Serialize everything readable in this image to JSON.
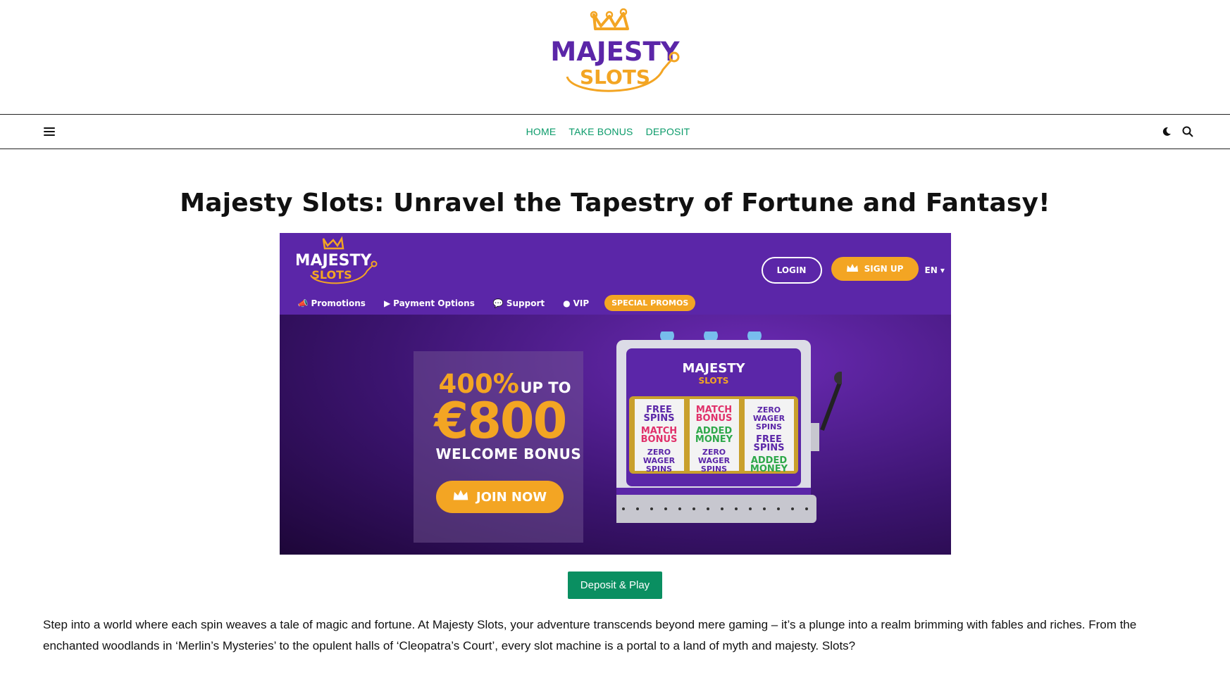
{
  "site": {
    "logo_top": "MAJESTY",
    "logo_bottom": "SLOTS"
  },
  "nav": {
    "links": [
      "HOME",
      "TAKE BONUS",
      "DEPOSIT"
    ],
    "menu_icon": "hamburger-icon",
    "dark_mode_icon": "moon-icon",
    "search_icon": "search-icon"
  },
  "article": {
    "title": "Majesty Slots: Unravel the Tapestry of Fortune and Fantasy!",
    "cta_label": "Deposit & Play",
    "body": "Step into a world where each spin weaves a tale of magic and fortune. At Majesty Slots, your adventure transcends beyond mere gaming – it’s a plunge into a realm brimming with fables and riches. From the enchanted woodlands in ‘Merlin’s Mysteries’ to the opulent halls of ‘Cleopatra’s Court’, every slot machine is a portal to a land of myth and majesty. Slots?"
  },
  "banner": {
    "logo_top": "MAJESTY",
    "logo_bottom": "SLOTS",
    "login": "LOGIN",
    "signup": "SIGN UP",
    "lang": "EN",
    "menu": [
      "Promotions",
      "Payment Options",
      "Support",
      "VIP"
    ],
    "special": "SPECIAL PROMOS",
    "percent": "400%",
    "up_to": "UP TO",
    "amount": "€800",
    "welcome": "WELCOME BONUS",
    "join": "JOIN NOW",
    "machine_logo_top": "MAJESTY",
    "machine_logo_bottom": "SLOTS",
    "reels": [
      [
        "FREE SPINS",
        "MATCH BONUS",
        "ZERO WAGER SPINS"
      ],
      [
        "MATCH BONUS",
        "ADDED MONEY",
        "ZERO WAGER SPINS"
      ],
      [
        "ZERO WAGER SPINS",
        "FREE SPINS",
        "ADDED MONEY"
      ]
    ]
  },
  "colors": {
    "accent_green": "#0b9b6a",
    "cta_green": "#0a8f61",
    "brand_purple": "#5b26a8",
    "brand_orange": "#f3a523"
  }
}
